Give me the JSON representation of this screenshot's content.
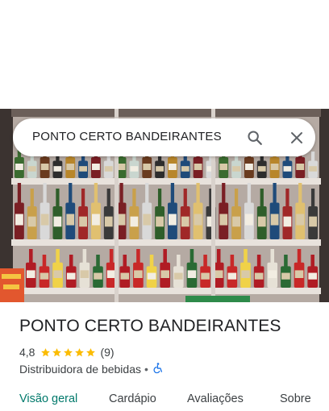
{
  "search": {
    "query": "PONTO CERTO BANDEIRANTES"
  },
  "place": {
    "name": "PONTO CERTO BANDEIRANTES",
    "rating": "4,8",
    "rating_stars": 5,
    "review_count": "(9)",
    "category": "Distribuidora de bebidas",
    "separator": "•"
  },
  "tabs": [
    {
      "label": "Visão geral",
      "active": true
    },
    {
      "label": "Cardápio",
      "active": false
    },
    {
      "label": "Avaliações",
      "active": false
    },
    {
      "label": "Sobre",
      "active": false
    }
  ],
  "colors": {
    "accent": "#00796b",
    "star": "#fbbc04",
    "accessibility": "#1a73e8",
    "text_primary": "#202124",
    "text_secondary": "#3c4043"
  },
  "icons": [
    "search-icon",
    "close-icon",
    "star-icon",
    "wheelchair-accessible-icon"
  ]
}
